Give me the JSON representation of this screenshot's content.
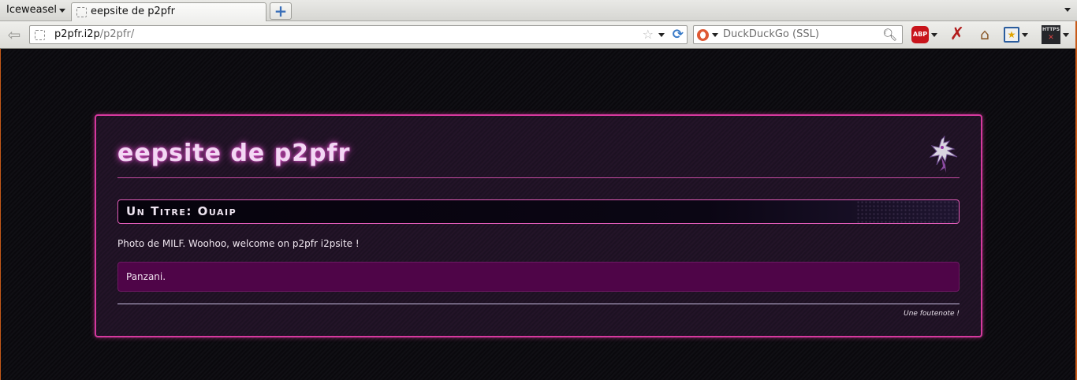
{
  "browser": {
    "app_menu_label": "Iceweasel",
    "tab_title": "eepsite de p2pfr",
    "new_tab_symbol": "+",
    "url_host": "p2pfr.i2p",
    "url_path": "/p2pfr/",
    "search_engine": "DuckDuckGo (SSL)",
    "toolbar": {
      "adblock_label": "ABP",
      "https_label": "HTTPS"
    }
  },
  "page": {
    "site_title": "eepsite de p2pfr",
    "section_title": "Un Titre: Ouaip",
    "body_text": "Photo de MILF. Woohoo, welcome on p2pfr i2psite !",
    "quote_text": "Panzani.",
    "footnote": "Une foutenote !"
  },
  "colors": {
    "accent": "#d6399e",
    "card_background": "#231428",
    "quote_background": "#4f0548",
    "title_glow": "#d94fc5"
  },
  "icons": [
    "back-arrow-icon",
    "page-favicon-icon",
    "bookmark-star-icon",
    "reload-icon",
    "duckduckgo-icon",
    "search-icon",
    "adblock-icon",
    "noscript-icon",
    "home-icon",
    "bookmarks-icon",
    "https-everywhere-icon",
    "site-logo-icon"
  ]
}
